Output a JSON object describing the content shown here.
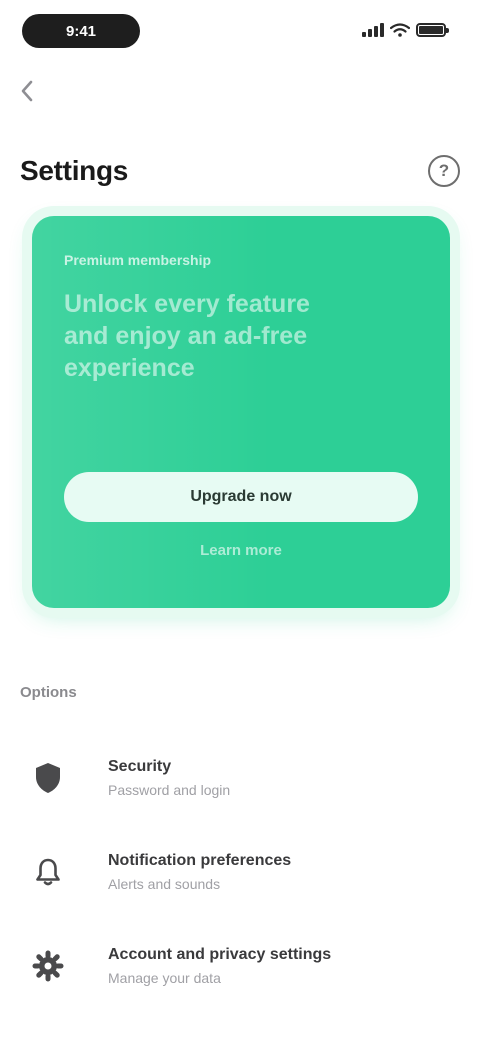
{
  "status_bar": {
    "time": "9:41"
  },
  "header": {
    "back_icon": "chevron-left-icon",
    "title": "Settings",
    "help_icon": "question-mark-icon",
    "help_label": "?"
  },
  "premium_card": {
    "eyebrow": "Premium membership",
    "headline": "Unlock every feature and enjoy an ad-free experience",
    "cta_label": "Upgrade now",
    "secondary_label": "Learn more",
    "accent_color": "#2dcf96"
  },
  "options": {
    "section_label": "Options",
    "items": [
      {
        "icon": "shield-icon",
        "title": "Security",
        "subtitle": "Password and login"
      },
      {
        "icon": "bell-icon",
        "title": "Notification preferences",
        "subtitle": "Alerts and sounds"
      },
      {
        "icon": "settings-icon",
        "title": "Account and privacy settings",
        "subtitle": "Manage your data"
      }
    ]
  }
}
